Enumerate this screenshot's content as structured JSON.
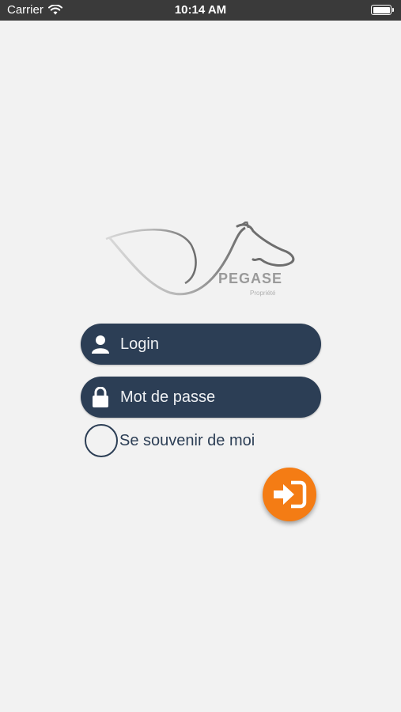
{
  "status_bar": {
    "carrier": "Carrier",
    "time": "10:14 AM",
    "wifi_icon": "wifi-icon",
    "battery_icon": "battery-icon"
  },
  "logo": {
    "brand": "PEGASE",
    "tagline": "Propriété"
  },
  "form": {
    "login_placeholder": "Login",
    "password_placeholder": "Mot de passe",
    "remember_label": "Se souvenir de moi",
    "remember_checked": false,
    "login_icon": "user-icon",
    "password_icon": "lock-icon",
    "submit_icon": "sign-in-icon"
  },
  "colors": {
    "background": "#f2f2f2",
    "field_bg": "#2c3e55",
    "accent": "#f47c14",
    "status_bar": "#3a3a3a"
  }
}
